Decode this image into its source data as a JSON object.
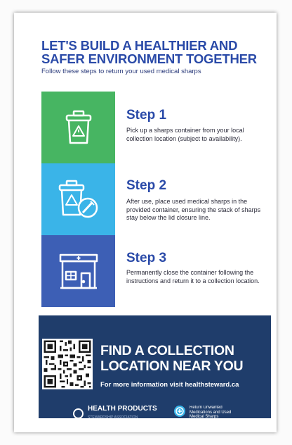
{
  "header": {
    "title_line1": "LET'S BUILD A HEALTHIER AND",
    "title_line2": "SAFER ENVIRONMENT TOGETHER",
    "subtitle": "Follow these steps to return your used medical sharps"
  },
  "steps": [
    {
      "title": "Step 1",
      "text": "Pick up a sharps container from your local collection location (subject to availability).",
      "icon": "sharps-bin-icon",
      "color": "#47b562"
    },
    {
      "title": "Step 2",
      "text": "After use, place used medical sharps in the provided container, ensuring the stack of sharps stay below the lid closure line.",
      "icon": "sharps-bin-syringe-icon",
      "color": "#3ab4e8"
    },
    {
      "title": "Step 3",
      "text": "Permanently close the container following the instructions and return it to a collection location.",
      "icon": "pharmacy-store-icon",
      "color": "#3d5fb5"
    }
  ],
  "cta": {
    "title_line1": "FIND A COLLECTION",
    "title_line2": "LOCATION NEAR YOU",
    "info": "For more information visit healthsteward.ca",
    "background": "#1f3d6b"
  },
  "logos": {
    "hpsa_name": "HEALTH PRODUCTS",
    "hpsa_sub": "STEWARDSHIP ASSOCIATION",
    "return_text": "Return Unwanted Medications and Used Medical Sharps"
  }
}
